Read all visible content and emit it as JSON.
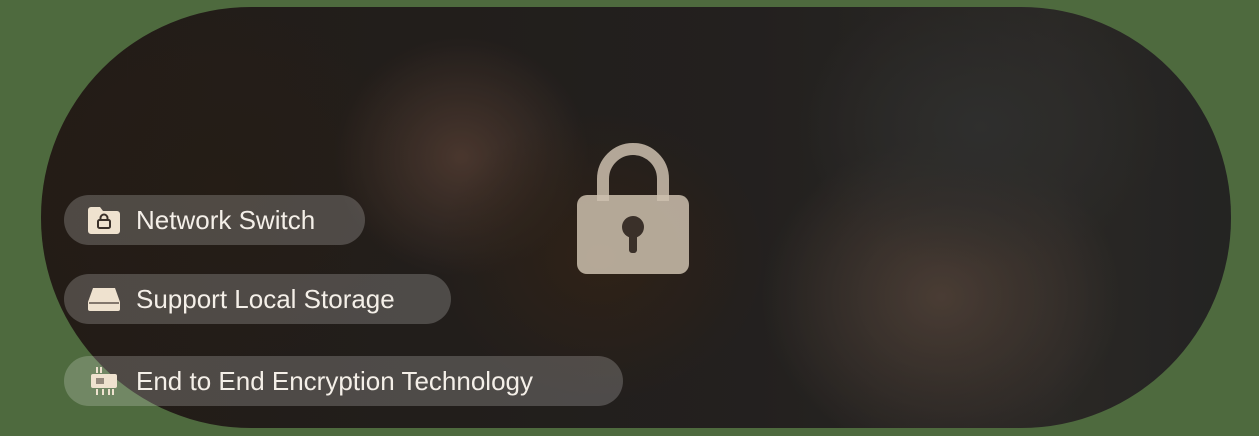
{
  "features": [
    {
      "label": "Network Switch",
      "icon": "folder-lock-icon"
    },
    {
      "label": "Support Local Storage",
      "icon": "hard-drive-icon"
    },
    {
      "label": "End to End Encryption Technology",
      "icon": "chip-icon"
    }
  ],
  "center_icon": "padlock-icon",
  "colors": {
    "frame": "#4e6a3e",
    "accent": "#e9dccb"
  }
}
